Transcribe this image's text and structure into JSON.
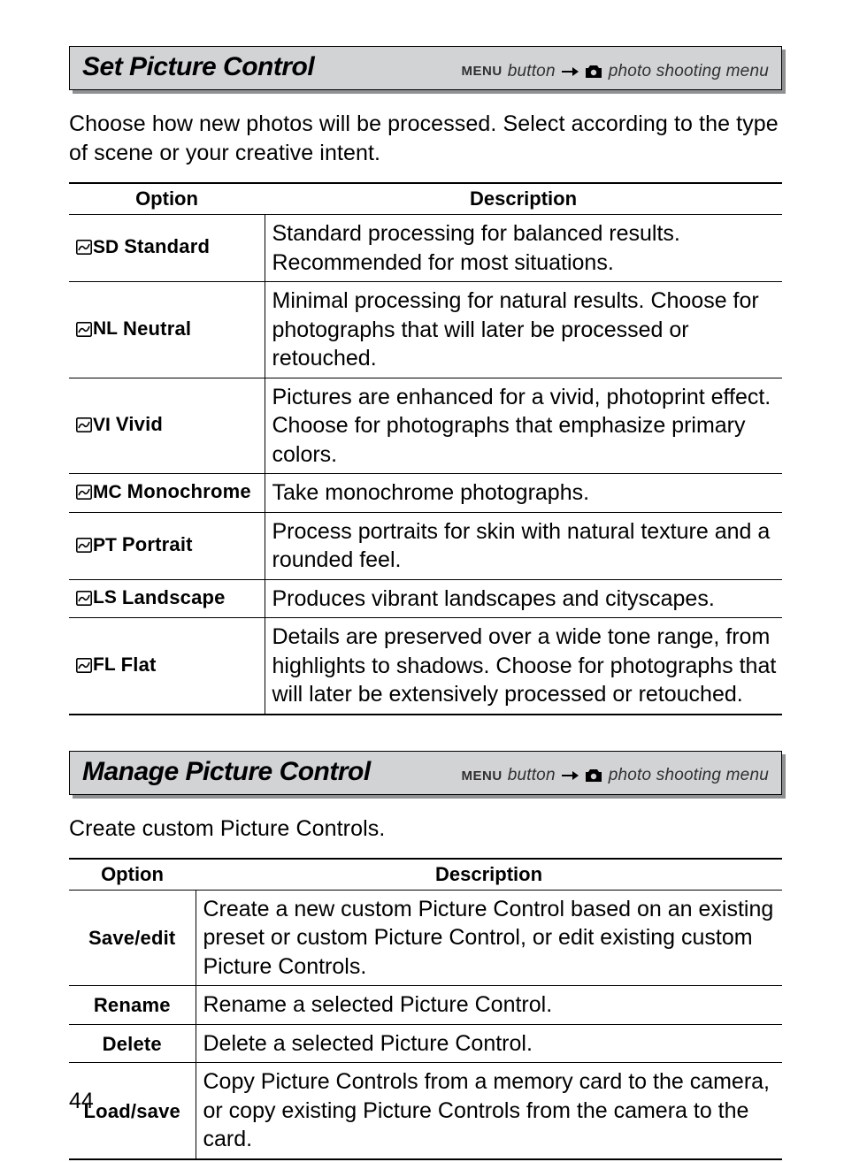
{
  "section1": {
    "title": "Set Picture Control",
    "nav": {
      "menu": "MENU",
      "button": "button",
      "dest": "photo shooting menu"
    },
    "intro": "Choose how new photos will be processed.  Select according to the type of scene or your creative intent.",
    "columns": [
      "Option",
      "Description"
    ],
    "rows": [
      {
        "code": "SD",
        "label": "Standard",
        "desc": "Standard processing for balanced results. Recommended for most situations."
      },
      {
        "code": "NL",
        "label": "Neutral",
        "desc": "Minimal processing for natural results.  Choose for photographs that will later be processed or retouched."
      },
      {
        "code": "VI",
        "label": "Vivid",
        "desc": "Pictures are enhanced for a vivid, photoprint effect. Choose for photographs that emphasize primary colors."
      },
      {
        "code": "MC",
        "label": "Monochrome",
        "desc": "Take monochrome photographs."
      },
      {
        "code": "PT",
        "label": "Portrait",
        "desc": "Process portraits for skin with natural texture and a rounded feel."
      },
      {
        "code": "LS",
        "label": "Landscape",
        "desc": "Produces vibrant landscapes and cityscapes."
      },
      {
        "code": "FL",
        "label": "Flat",
        "desc": "Details are preserved over a wide tone range, from highlights to shadows.  Choose for photographs that will later be extensively processed or retouched."
      }
    ]
  },
  "section2": {
    "title": "Manage Picture Control",
    "nav": {
      "menu": "MENU",
      "button": "button",
      "dest": "photo shooting menu"
    },
    "intro": "Create custom Picture Controls.",
    "columns": [
      "Option",
      "Description"
    ],
    "rows": [
      {
        "label": "Save/edit",
        "desc": "Create a new custom Picture Control based on an existing preset or custom Picture Control, or edit existing custom Picture Controls."
      },
      {
        "label": "Rename",
        "desc": "Rename a selected Picture Control."
      },
      {
        "label": "Delete",
        "desc": "Delete a selected Picture Control."
      },
      {
        "label": "Load/save",
        "desc": "Copy Picture Controls from a memory card to the camera, or copy existing Picture Controls from the camera to the card."
      }
    ]
  },
  "page_number": "44"
}
